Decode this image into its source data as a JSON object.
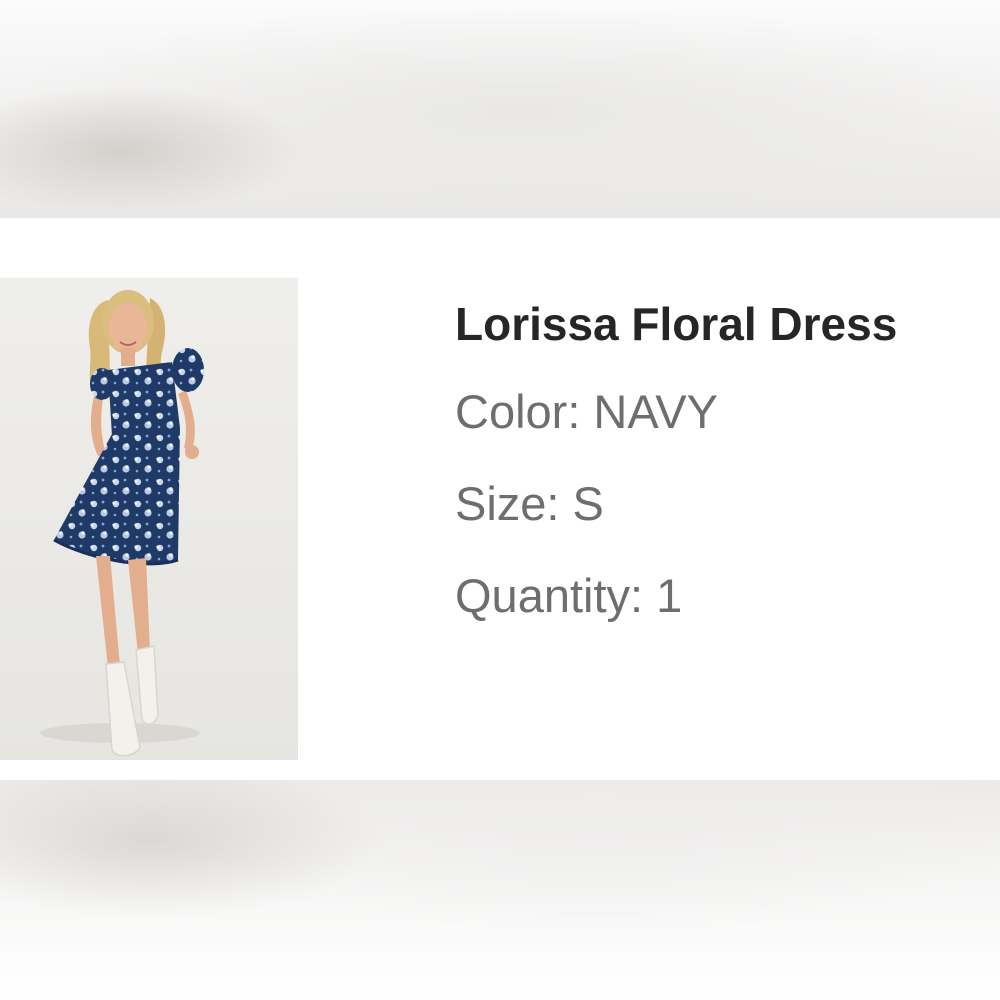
{
  "product": {
    "image_subject": "model-wearing-navy-floral-dress",
    "title": "Lorissa Floral Dress",
    "color_line": "Color: NAVY",
    "size_line": "Size: S",
    "quantity_line": "Quantity: 1"
  },
  "colors": {
    "title_text": "#262626",
    "detail_text": "#6e6e6e",
    "dress_navy": "#1f3a66"
  }
}
